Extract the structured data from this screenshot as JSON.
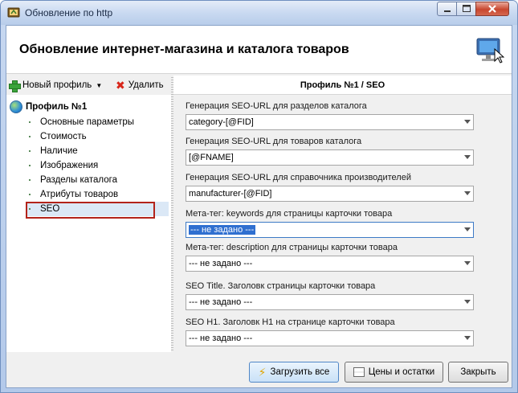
{
  "window": {
    "title": "Обновление по http"
  },
  "header": {
    "title": "Обновление интернет-магазина и каталога товаров"
  },
  "left_toolbar": {
    "new_profile": "Новый профиль",
    "delete": "Удалить"
  },
  "tree": {
    "root": "Профиль №1",
    "items": [
      {
        "label": "Основные параметры"
      },
      {
        "label": "Стоимость"
      },
      {
        "label": "Наличие"
      },
      {
        "label": "Изображения"
      },
      {
        "label": "Разделы каталога"
      },
      {
        "label": "Атрибуты товаров"
      },
      {
        "label": "SEO"
      }
    ],
    "selected": "SEO"
  },
  "profile": {
    "title": "Профиль №1 / SEO"
  },
  "fields": [
    {
      "label": "Генерация SEO-URL для разделов каталога",
      "value": "category-[@FID]"
    },
    {
      "label": "Генерация SEO-URL для товаров каталога",
      "value": "[@FNAME]"
    },
    {
      "label": "Генерация SEO-URL для справочника производителей",
      "value": "manufacturer-[@FID]"
    },
    {
      "label": "Мета-тег: keywords  для страницы карточки товара",
      "value": "--- не задано ---"
    },
    {
      "label": "Мета-тег: description  для страницы карточки товара",
      "value": "--- не задано ---"
    },
    {
      "label": "SEO Title. Заголовк страницы карточки товара",
      "value": "--- не задано ---"
    },
    {
      "label": "SEO H1. Заголовк H1 на странице карточки товара",
      "value": "--- не задано ---"
    }
  ],
  "buttons": {
    "load_all": "Загрузить все",
    "prices_stock": "Цены и остатки",
    "close": "Закрыть"
  },
  "colors": {
    "selection_outline": "#b3231a",
    "focus_highlight": "#2f6fd0",
    "tree_selected": "#dbe8f6"
  }
}
